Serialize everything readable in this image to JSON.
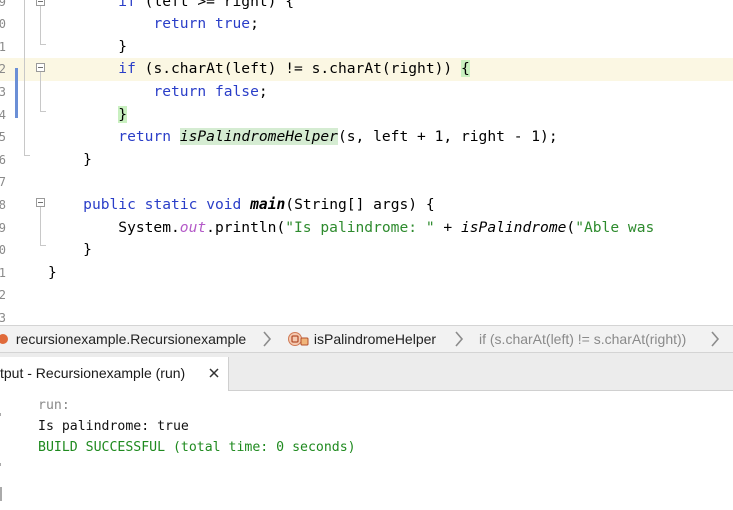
{
  "editor": {
    "lines": [
      {
        "num": "9",
        "segments": [
          {
            "t": "        ",
            "c": ""
          },
          {
            "t": "if",
            "c": "kw"
          },
          {
            "t": " (left >= right) {",
            "c": ""
          }
        ]
      },
      {
        "num": "0",
        "segments": [
          {
            "t": "            ",
            "c": ""
          },
          {
            "t": "return",
            "c": "kw"
          },
          {
            "t": " ",
            "c": ""
          },
          {
            "t": "true",
            "c": "kw"
          },
          {
            "t": ";",
            "c": ""
          }
        ]
      },
      {
        "num": "1",
        "segments": [
          {
            "t": "        }",
            "c": ""
          }
        ]
      },
      {
        "num": "2",
        "segments": [
          {
            "t": "        ",
            "c": ""
          },
          {
            "t": "if",
            "c": "kw"
          },
          {
            "t": " (s.charAt(left) != s.charAt(right)) ",
            "c": ""
          },
          {
            "t": "{",
            "c": "brace-mark"
          }
        ]
      },
      {
        "num": "3",
        "segments": [
          {
            "t": "            ",
            "c": ""
          },
          {
            "t": "return",
            "c": "kw"
          },
          {
            "t": " ",
            "c": ""
          },
          {
            "t": "false",
            "c": "kw"
          },
          {
            "t": ";",
            "c": ""
          }
        ]
      },
      {
        "num": "4",
        "segments": [
          {
            "t": "        ",
            "c": ""
          },
          {
            "t": "}",
            "c": "brace-mark"
          }
        ]
      },
      {
        "num": "5",
        "segments": [
          {
            "t": "        ",
            "c": ""
          },
          {
            "t": "return",
            "c": "kw"
          },
          {
            "t": " ",
            "c": ""
          },
          {
            "t": "isPalindromeHelper",
            "c": "ital mark"
          },
          {
            "t": "(s, left + 1, right - 1);",
            "c": ""
          }
        ]
      },
      {
        "num": "6",
        "segments": [
          {
            "t": "    }",
            "c": ""
          }
        ]
      },
      {
        "num": "7",
        "segments": [
          {
            "t": "",
            "c": ""
          }
        ]
      },
      {
        "num": "8",
        "segments": [
          {
            "t": "    ",
            "c": ""
          },
          {
            "t": "public",
            "c": "kw"
          },
          {
            "t": " ",
            "c": ""
          },
          {
            "t": "static",
            "c": "kw"
          },
          {
            "t": " ",
            "c": ""
          },
          {
            "t": "void",
            "c": "kw"
          },
          {
            "t": " ",
            "c": ""
          },
          {
            "t": "main",
            "c": "meth"
          },
          {
            "t": "(String[] args) {",
            "c": ""
          }
        ]
      },
      {
        "num": "9",
        "segments": [
          {
            "t": "        System.",
            "c": ""
          },
          {
            "t": "out",
            "c": "fld"
          },
          {
            "t": ".println(",
            "c": ""
          },
          {
            "t": "\"Is palindrome: \"",
            "c": "str"
          },
          {
            "t": " + ",
            "c": ""
          },
          {
            "t": "isPalindrome",
            "c": "ital"
          },
          {
            "t": "(",
            "c": ""
          },
          {
            "t": "\"Able was",
            "c": "str"
          }
        ]
      },
      {
        "num": "0",
        "segments": [
          {
            "t": "    }",
            "c": ""
          }
        ]
      },
      {
        "num": "1",
        "segments": [
          {
            "t": "}",
            "c": ""
          }
        ]
      },
      {
        "num": "2",
        "segments": [
          {
            "t": "",
            "c": ""
          }
        ]
      },
      {
        "num": "3",
        "segments": [
          {
            "t": "",
            "c": ""
          }
        ]
      }
    ],
    "highlighted_line": 3
  },
  "breadcrumb": {
    "class_label": "recursionexample.Recursionexample",
    "method_label": "isPalindromeHelper",
    "statement_label": "if (s.charAt(left) != s.charAt(right))"
  },
  "output": {
    "tab_label": "tput - Recursionexample (run)",
    "run_label": "run:",
    "result_line": "Is palindrome: true",
    "build_line": "BUILD SUCCESSFUL (total time: 0 seconds)"
  },
  "icons": {
    "class_icon": "class-icon",
    "method_icon": "method-icon",
    "separator": "chevron-right-icon",
    "close": "close-icon",
    "fold": "fold-toggle-icon"
  },
  "colors": {
    "keyword": "#2a3ec8",
    "string": "#2e8b2e",
    "field": "#b45ac8",
    "highlight_line": "#fbf7e3",
    "build_success": "#1f8a1f"
  }
}
